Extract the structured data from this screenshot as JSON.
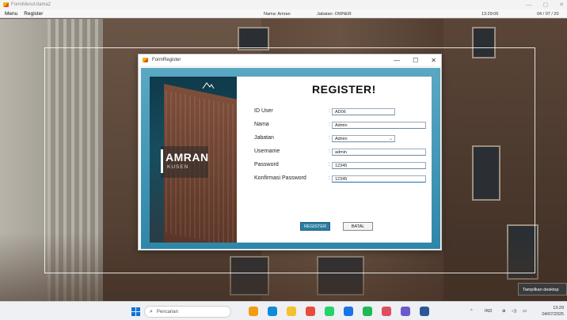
{
  "main_window": {
    "title": "FormMenuUtama2",
    "controls": {
      "minimize": "—",
      "maximize": "▢",
      "close": "✕"
    }
  },
  "menubar": {
    "items": [
      "Menu",
      "Register"
    ],
    "nama": "Nama: Amran",
    "jabatan": "Jabatan: OWNER",
    "time": "13:29:06",
    "date": "04 / 07 / 20"
  },
  "dialog": {
    "title": "FormRegister",
    "controls": {
      "minimize": "—",
      "maximize": "☐",
      "close": "✕"
    },
    "heading": "REGISTER!",
    "brand": {
      "name": "AMRAN",
      "sub": "KUSEN"
    },
    "fields": [
      {
        "label": "ID User",
        "value": "AD06"
      },
      {
        "label": "Nama",
        "value": "Admin"
      },
      {
        "label": "Jabatan",
        "value": "Admin"
      },
      {
        "label": "Username",
        "value": "admin"
      },
      {
        "label": "Password",
        "value": "12345"
      },
      {
        "label": "Konfirmasi Password",
        "value": "12345"
      }
    ],
    "buttons": {
      "register": "REGISTER",
      "batal": "BATAL"
    }
  },
  "tooltip": "Tampilkan desktop",
  "taskbar": {
    "search_placeholder": "Pencarian",
    "lang": "IND",
    "time": "13:29",
    "date": "04/07/2025",
    "apps": [
      "pinwheel",
      "edge",
      "files",
      "chrome",
      "whatsapp",
      "chrome-alt",
      "spotify",
      "app-red",
      "copilot",
      "word"
    ],
    "app_colors": [
      "#f39c12",
      "#0f8bd8",
      "#f2c230",
      "#e74c3c",
      "#25d366",
      "#1a73e8",
      "#1db954",
      "#e04f5f",
      "#6a5acd",
      "#2b579a"
    ]
  }
}
